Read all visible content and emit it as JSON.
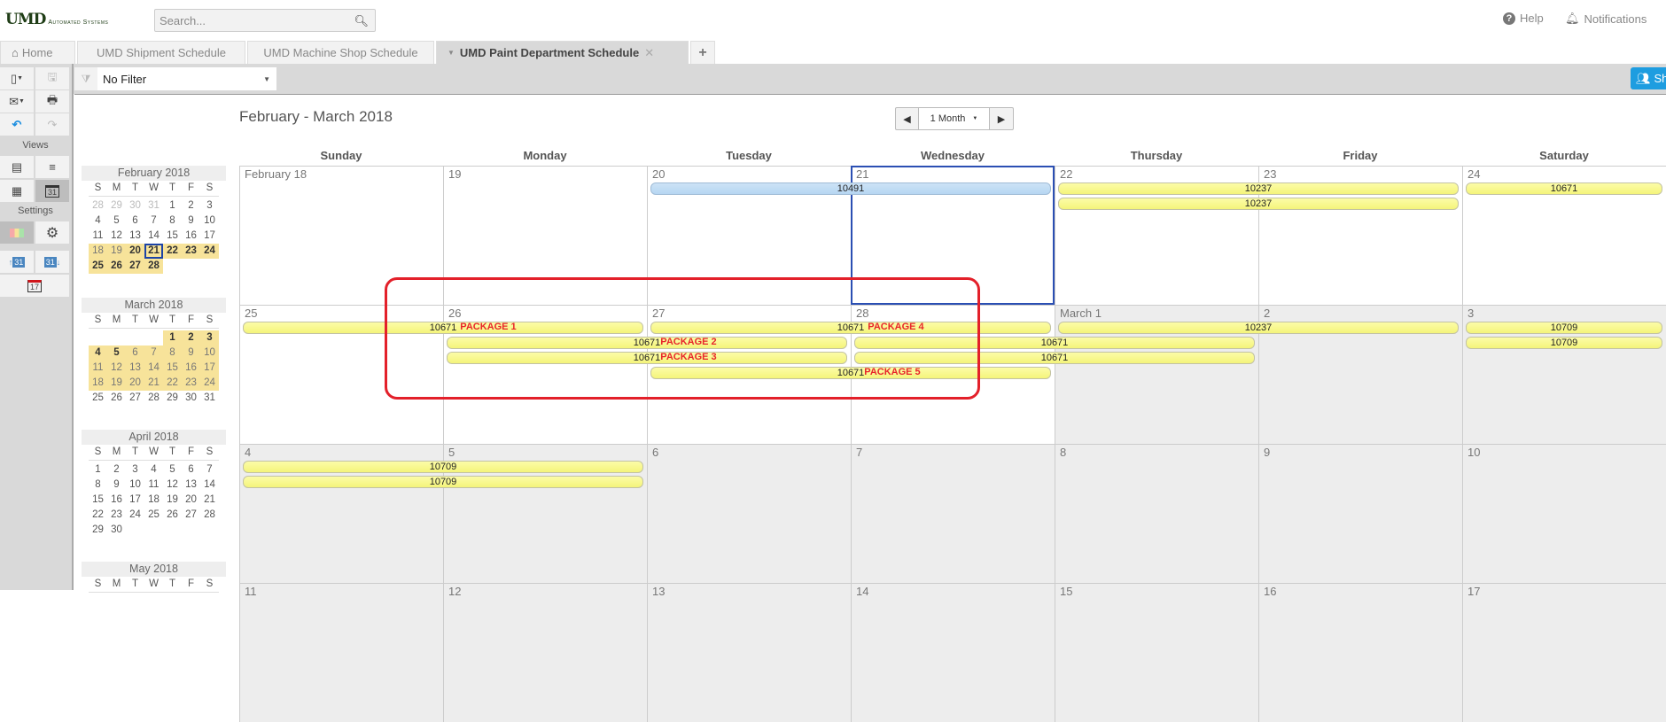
{
  "header": {
    "logo_mark": "UMD",
    "logo_sub": "Automated Systems",
    "search_placeholder": "Search...",
    "help": "Help",
    "notifications": "Notifications"
  },
  "tabs": [
    {
      "label": "Home",
      "icon": "home-icon"
    },
    {
      "label": "UMD Shipment Schedule"
    },
    {
      "label": "UMD Machine Shop Schedule"
    },
    {
      "label": "UMD Paint Department Schedule",
      "active": true
    },
    {
      "label": "+"
    }
  ],
  "sidebar": {
    "views_label": "Views",
    "settings_label": "Settings",
    "today_icon_day": "17",
    "cal_icon_day": "31"
  },
  "filter": {
    "value": "No Filter"
  },
  "share_label": "Sh",
  "calendar": {
    "title": "February - March 2018",
    "view": "1 Month",
    "day_headers": [
      "Sunday",
      "Monday",
      "Tuesday",
      "Wednesday",
      "Thursday",
      "Friday",
      "Saturday"
    ],
    "weeks": [
      {
        "days": [
          {
            "label": "February 18"
          },
          {
            "label": "19"
          },
          {
            "label": "20"
          },
          {
            "label": "21",
            "today": true
          },
          {
            "label": "22"
          },
          {
            "label": "23"
          },
          {
            "label": "24"
          }
        ],
        "events": [
          {
            "label": "10491",
            "start": 2,
            "span": 2,
            "lane": 0,
            "color": "blue"
          },
          {
            "label": "10237",
            "start": 4,
            "span": 2,
            "lane": 0
          },
          {
            "label": "10237",
            "start": 4,
            "span": 2,
            "lane": 1
          },
          {
            "label": "10671",
            "start": 6,
            "span": 2,
            "lane": 0
          }
        ]
      },
      {
        "days": [
          {
            "label": "25"
          },
          {
            "label": "26"
          },
          {
            "label": "27"
          },
          {
            "label": "28"
          },
          {
            "label": "March 1",
            "shaded": true
          },
          {
            "label": "2",
            "shaded": true
          },
          {
            "label": "3",
            "shaded": true
          }
        ],
        "events": [
          {
            "label": "10671",
            "package": "PACKAGE 1",
            "start": 0,
            "span": 2,
            "lane": 0
          },
          {
            "label": "10671",
            "package": "PACKAGE 4",
            "start": 2,
            "span": 2,
            "lane": 0
          },
          {
            "label": "10237",
            "start": 4,
            "span": 2,
            "lane": 0
          },
          {
            "label": "10709",
            "start": 6,
            "span": 2,
            "lane": 0
          },
          {
            "label": "10671",
            "package": "PACKAGE 2",
            "start": 1,
            "span": 2,
            "lane": 1
          },
          {
            "label": "10671",
            "start": 3,
            "span": 2,
            "lane": 1
          },
          {
            "label": "10709",
            "start": 6,
            "span": 2,
            "lane": 1
          },
          {
            "label": "10671",
            "package": "PACKAGE 3",
            "start": 1,
            "span": 2,
            "lane": 2
          },
          {
            "label": "10671",
            "start": 3,
            "span": 2,
            "lane": 2
          },
          {
            "label": "10671",
            "package": "PACKAGE 5",
            "start": 2,
            "span": 2,
            "lane": 3
          }
        ]
      },
      {
        "days": [
          {
            "label": "4",
            "shaded": true
          },
          {
            "label": "5",
            "shaded": true
          },
          {
            "label": "6",
            "shaded": true
          },
          {
            "label": "7",
            "shaded": true
          },
          {
            "label": "8",
            "shaded": true
          },
          {
            "label": "9",
            "shaded": true
          },
          {
            "label": "10",
            "shaded": true
          }
        ],
        "events": [
          {
            "label": "10709",
            "start": 0,
            "span": 2,
            "lane": 0
          },
          {
            "label": "10709",
            "start": 0,
            "span": 2,
            "lane": 1
          }
        ]
      },
      {
        "days": [
          {
            "label": "11",
            "shaded": true
          },
          {
            "label": "12",
            "shaded": true
          },
          {
            "label": "13",
            "shaded": true
          },
          {
            "label": "14",
            "shaded": true
          },
          {
            "label": "15",
            "shaded": true
          },
          {
            "label": "16",
            "shaded": true
          },
          {
            "label": "17",
            "shaded": true
          }
        ],
        "events": []
      }
    ]
  },
  "mini_calendars": [
    {
      "title": "February 2018",
      "dow": [
        "S",
        "M",
        "T",
        "W",
        "T",
        "F",
        "S"
      ],
      "weeks": [
        [
          [
            "28",
            "m"
          ],
          [
            "29",
            "m"
          ],
          [
            "30",
            "m"
          ],
          [
            "31",
            "m"
          ],
          [
            "1",
            ""
          ],
          [
            "2",
            ""
          ],
          [
            "3",
            ""
          ]
        ],
        [
          [
            "4",
            ""
          ],
          [
            "5",
            ""
          ],
          [
            "6",
            ""
          ],
          [
            "7",
            ""
          ],
          [
            "8",
            ""
          ],
          [
            "9",
            ""
          ],
          [
            "10",
            ""
          ]
        ],
        [
          [
            "11",
            ""
          ],
          [
            "12",
            ""
          ],
          [
            "13",
            ""
          ],
          [
            "14",
            ""
          ],
          [
            "15",
            ""
          ],
          [
            "16",
            ""
          ],
          [
            "17",
            ""
          ]
        ],
        [
          [
            "18",
            "h"
          ],
          [
            "19",
            "h"
          ],
          [
            "20",
            "hb"
          ],
          [
            "21",
            "hb t"
          ],
          [
            "22",
            "hb"
          ],
          [
            "23",
            "hb"
          ],
          [
            "24",
            "hb"
          ]
        ],
        [
          [
            "25",
            "hb"
          ],
          [
            "26",
            "hb"
          ],
          [
            "27",
            "hb"
          ],
          [
            "28",
            "hb"
          ]
        ]
      ]
    },
    {
      "title": "March 2018",
      "dow": [
        "S",
        "M",
        "T",
        "W",
        "T",
        "F",
        "S"
      ],
      "weeks": [
        [
          [
            "",
            ""
          ],
          [
            "",
            ""
          ],
          [
            "",
            ""
          ],
          [
            "",
            ""
          ],
          [
            "1",
            "hb"
          ],
          [
            "2",
            "hb"
          ],
          [
            "3",
            "hb"
          ]
        ],
        [
          [
            "4",
            "hb"
          ],
          [
            "5",
            "hb"
          ],
          [
            "6",
            "h"
          ],
          [
            "7",
            "h"
          ],
          [
            "8",
            "h"
          ],
          [
            "9",
            "h"
          ],
          [
            "10",
            "h"
          ]
        ],
        [
          [
            "11",
            "h"
          ],
          [
            "12",
            "h"
          ],
          [
            "13",
            "h"
          ],
          [
            "14",
            "h"
          ],
          [
            "15",
            "h"
          ],
          [
            "16",
            "h"
          ],
          [
            "17",
            "h"
          ]
        ],
        [
          [
            "18",
            "h"
          ],
          [
            "19",
            "h"
          ],
          [
            "20",
            "h"
          ],
          [
            "21",
            "h"
          ],
          [
            "22",
            "h"
          ],
          [
            "23",
            "h"
          ],
          [
            "24",
            "h"
          ]
        ],
        [
          [
            "25",
            ""
          ],
          [
            "26",
            ""
          ],
          [
            "27",
            ""
          ],
          [
            "28",
            ""
          ],
          [
            "29",
            ""
          ],
          [
            "30",
            ""
          ],
          [
            "31",
            ""
          ]
        ]
      ]
    },
    {
      "title": "April 2018",
      "dow": [
        "S",
        "M",
        "T",
        "W",
        "T",
        "F",
        "S"
      ],
      "weeks": [
        [
          [
            "1",
            ""
          ],
          [
            "2",
            ""
          ],
          [
            "3",
            ""
          ],
          [
            "4",
            ""
          ],
          [
            "5",
            ""
          ],
          [
            "6",
            ""
          ],
          [
            "7",
            ""
          ]
        ],
        [
          [
            "8",
            ""
          ],
          [
            "9",
            ""
          ],
          [
            "10",
            ""
          ],
          [
            "11",
            ""
          ],
          [
            "12",
            ""
          ],
          [
            "13",
            ""
          ],
          [
            "14",
            ""
          ]
        ],
        [
          [
            "15",
            ""
          ],
          [
            "16",
            ""
          ],
          [
            "17",
            ""
          ],
          [
            "18",
            ""
          ],
          [
            "19",
            ""
          ],
          [
            "20",
            ""
          ],
          [
            "21",
            ""
          ]
        ],
        [
          [
            "22",
            ""
          ],
          [
            "23",
            ""
          ],
          [
            "24",
            ""
          ],
          [
            "25",
            ""
          ],
          [
            "26",
            ""
          ],
          [
            "27",
            ""
          ],
          [
            "28",
            ""
          ]
        ],
        [
          [
            "29",
            ""
          ],
          [
            "30",
            ""
          ]
        ]
      ]
    },
    {
      "title": "May 2018",
      "dow": [
        "S",
        "M",
        "T",
        "W",
        "T",
        "F",
        "S"
      ],
      "weeks": []
    }
  ],
  "colors": {
    "event_yellow": "#f8f88c",
    "event_blue": "#bcd9f2",
    "highlight": "#f7e39a",
    "today_border": "#2b4fb3",
    "annotation": "#e3202a",
    "share_button": "#1e9de0"
  }
}
